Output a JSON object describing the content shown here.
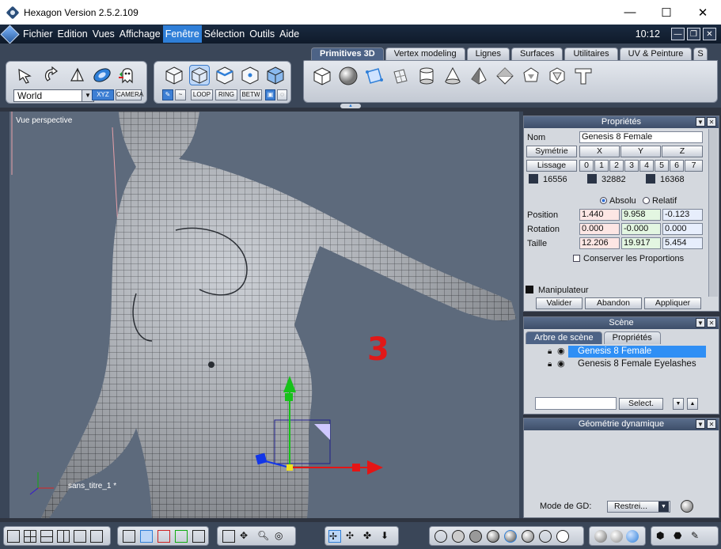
{
  "window": {
    "title": "Hexagon Version 2.5.2.109",
    "minimize": "—",
    "maximize": "☐",
    "close": "✕"
  },
  "menu": {
    "items": [
      "Fichier",
      "Edition",
      "Vues",
      "Affichage",
      "Fenêtre",
      "Sélection",
      "Outils",
      "Aide"
    ],
    "active_index": 4,
    "clock": "10:12"
  },
  "toolbar": {
    "coord_space": "World",
    "xyz_label": "XYZ",
    "camera_label": "CAMERA",
    "select_modes": [
      "LOOP",
      "RING",
      "BETW"
    ],
    "tabs": [
      "Primitives 3D",
      "Vertex modeling",
      "Lignes",
      "Surfaces",
      "Utilitaires",
      "UV & Peinture",
      "S"
    ],
    "active_tab": 0
  },
  "viewport": {
    "label": "Vue perspective",
    "file": "sans_titre_1 *",
    "overlay_number": "3"
  },
  "properties": {
    "title": "Propriétés",
    "name_label": "Nom",
    "name_value": "Genesis 8 Female",
    "symmetry_label": "Symétrie",
    "axes": [
      "X",
      "Y",
      "Z"
    ],
    "smoothing_label": "Lissage",
    "smoothing_levels": [
      "0",
      "1",
      "2",
      "3",
      "4",
      "5",
      "6",
      "7"
    ],
    "counts": [
      "16556",
      "32882",
      "16368"
    ],
    "absolute_label": "Absolu",
    "relative_label": "Relatif",
    "position_label": "Position",
    "position": [
      "1.440",
      "9.958",
      "-0.123"
    ],
    "rotation_label": "Rotation",
    "rotation": [
      "0.000",
      "-0.000",
      "0.000"
    ],
    "size_label": "Taille",
    "size": [
      "12.206",
      "19.917",
      "5.454"
    ],
    "keep_proportions": "Conserver les Proportions",
    "manipulator": "Manipulateur",
    "validate": "Valider",
    "cancel": "Abandon",
    "apply": "Appliquer"
  },
  "scene": {
    "title": "Scène",
    "tabs": [
      "Arbre de scène",
      "Propriétés"
    ],
    "items": [
      "Genesis 8 Female",
      "Genesis 8 Female Eyelashes"
    ],
    "select_button": "Select."
  },
  "dynamic_geometry": {
    "title": "Géométrie dynamique",
    "mode_label": "Mode de GD:",
    "mode_value": "Restrei..."
  },
  "colors": {
    "accent": "#2f7fd8",
    "panel": "#d4d8de",
    "header": "#4d6386",
    "viewport": "#5d6a7c"
  }
}
